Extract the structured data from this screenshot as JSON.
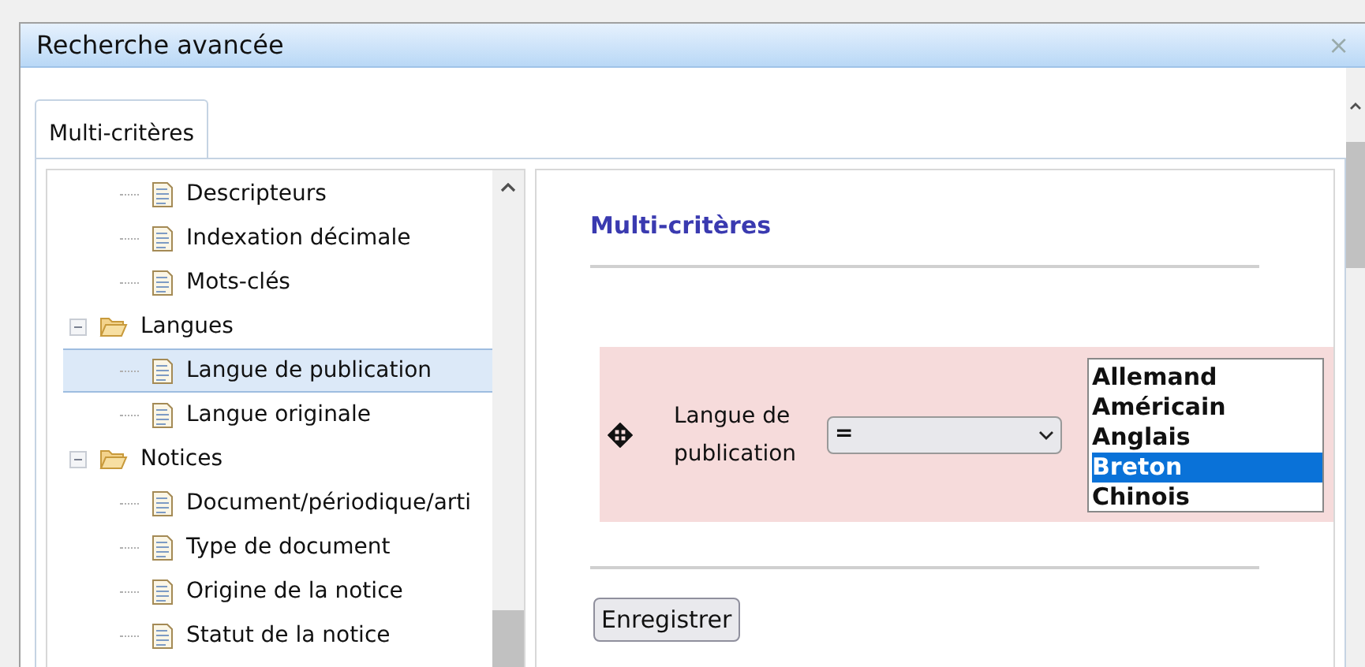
{
  "window": {
    "title": "Recherche avancée",
    "close": "×"
  },
  "tabs": [
    {
      "label": "Multi-critères",
      "selected": true
    }
  ],
  "tree": [
    {
      "children": [
        {
          "label": "Descripteurs",
          "selected": false
        },
        {
          "label": "Indexation décimale",
          "selected": false
        },
        {
          "label": "Mots-clés",
          "selected": false
        }
      ]
    },
    {
      "label": "Langues",
      "expanded": true,
      "children": [
        {
          "label": "Langue de publication",
          "selected": true
        },
        {
          "label": "Langue originale",
          "selected": false
        }
      ]
    },
    {
      "label": "Notices",
      "expanded": true,
      "children": [
        {
          "label": "Document/périodique/arti",
          "selected": false
        },
        {
          "label": "Type de document",
          "selected": false
        },
        {
          "label": "Origine de la notice",
          "selected": false
        },
        {
          "label": "Statut de la notice",
          "selected": false
        }
      ]
    }
  ],
  "panel": {
    "title": "Multi-critères",
    "criteria": [
      {
        "label": "Langue de publication",
        "operator": "=",
        "options": [
          {
            "label": "Allemand",
            "selected": false
          },
          {
            "label": "Américain",
            "selected": false
          },
          {
            "label": "Anglais",
            "selected": false
          },
          {
            "label": "Breton",
            "selected": true
          },
          {
            "label": "Chinois",
            "selected": false
          }
        ]
      }
    ],
    "save_button": "Enregistrer"
  }
}
